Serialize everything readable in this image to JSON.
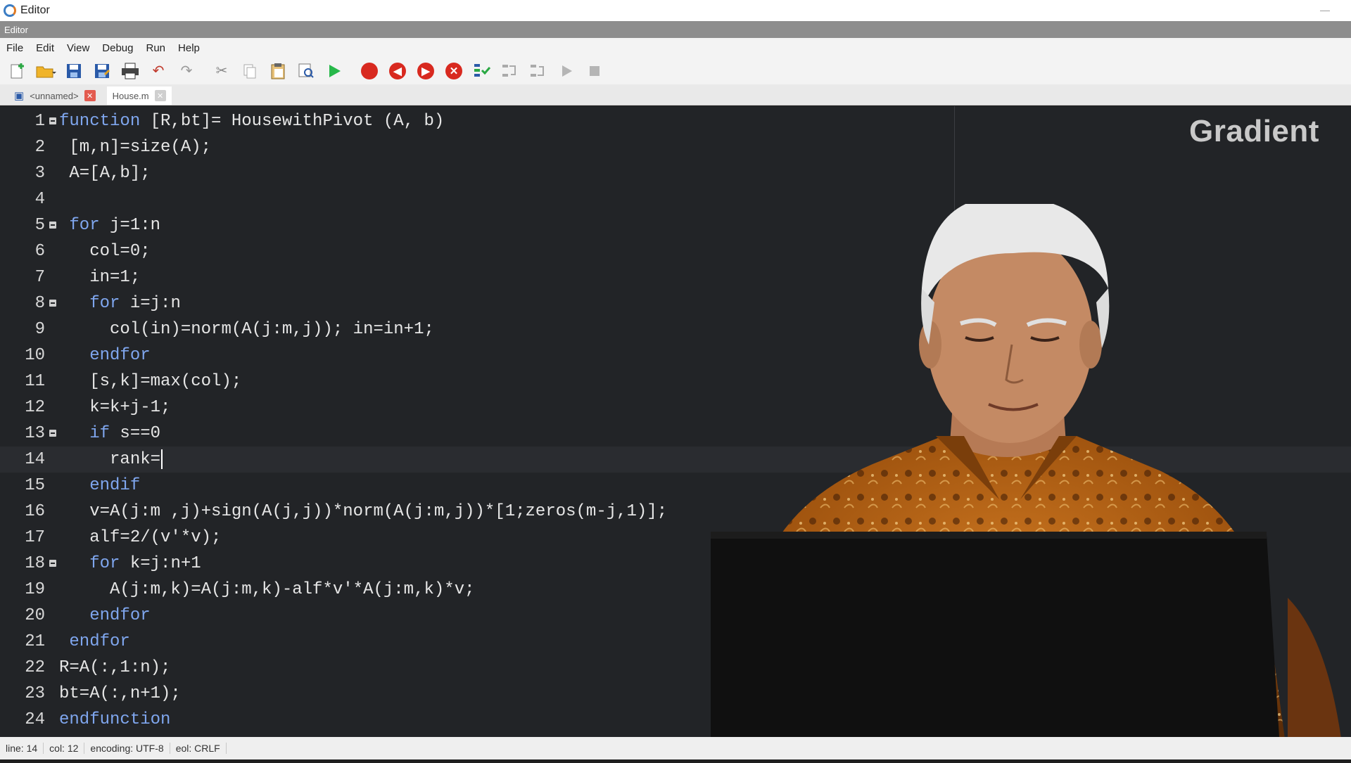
{
  "window": {
    "title": "Editor",
    "dock_title": "Editor"
  },
  "menu": [
    "File",
    "Edit",
    "View",
    "Debug",
    "Run",
    "Help"
  ],
  "toolbar": {
    "icons": [
      "new-script-icon",
      "open-folder-icon",
      "save-icon",
      "save-as-icon",
      "print-icon",
      "undo-icon",
      "redo-icon",
      "cut-icon",
      "copy-icon",
      "paste-icon",
      "find-icon",
      "run-icon",
      "breakpoint-icon",
      "previous-breakpoint-icon",
      "next-breakpoint-icon",
      "remove-breakpoints-icon",
      "step-in-icon",
      "step-over-icon",
      "step-out-icon",
      "continue-icon",
      "stop-icon"
    ]
  },
  "tabs": [
    {
      "label": "<unnamed>",
      "active": false
    },
    {
      "label": "House.m",
      "active": true
    }
  ],
  "editor": {
    "current_line": 14,
    "lines": [
      {
        "n": "1",
        "fold": true
      },
      {
        "n": "2",
        "fold": false
      },
      {
        "n": "3",
        "fold": false
      },
      {
        "n": "4",
        "fold": false
      },
      {
        "n": "5",
        "fold": true
      },
      {
        "n": "6",
        "fold": false
      },
      {
        "n": "7",
        "fold": false
      },
      {
        "n": "8",
        "fold": true
      },
      {
        "n": "9",
        "fold": false
      },
      {
        "n": "10",
        "fold": false
      },
      {
        "n": "11",
        "fold": false
      },
      {
        "n": "12",
        "fold": false
      },
      {
        "n": "13",
        "fold": true
      },
      {
        "n": "14",
        "fold": false
      },
      {
        "n": "15",
        "fold": false
      },
      {
        "n": "16",
        "fold": false
      },
      {
        "n": "17",
        "fold": false
      },
      {
        "n": "18",
        "fold": true
      },
      {
        "n": "19",
        "fold": false
      },
      {
        "n": "20",
        "fold": false
      },
      {
        "n": "21",
        "fold": false
      },
      {
        "n": "22",
        "fold": false
      },
      {
        "n": "23",
        "fold": false
      },
      {
        "n": "24",
        "fold": false
      }
    ],
    "code": [
      [
        {
          "k": true,
          "t": "function"
        },
        {
          "k": false,
          "t": " [R,bt]= HousewithPivot (A, b)"
        }
      ],
      [
        {
          "k": false,
          "t": " [m,n]=size(A);"
        }
      ],
      [
        {
          "k": false,
          "t": " A=[A,b];"
        }
      ],
      [
        {
          "k": false,
          "t": ""
        }
      ],
      [
        {
          "k": false,
          "t": " "
        },
        {
          "k": true,
          "t": "for"
        },
        {
          "k": false,
          "t": " j=1:n"
        }
      ],
      [
        {
          "k": false,
          "t": "   col=0;"
        }
      ],
      [
        {
          "k": false,
          "t": "   in=1;"
        }
      ],
      [
        {
          "k": false,
          "t": "   "
        },
        {
          "k": true,
          "t": "for"
        },
        {
          "k": false,
          "t": " i=j:n"
        }
      ],
      [
        {
          "k": false,
          "t": "     col(in)=norm(A(j:m,j)); in=in+1;"
        }
      ],
      [
        {
          "k": false,
          "t": "   "
        },
        {
          "k": true,
          "t": "endfor"
        }
      ],
      [
        {
          "k": false,
          "t": "   [s,k]=max(col);"
        }
      ],
      [
        {
          "k": false,
          "t": "   k=k+j-1;"
        }
      ],
      [
        {
          "k": false,
          "t": "   "
        },
        {
          "k": true,
          "t": "if"
        },
        {
          "k": false,
          "t": " s==0"
        }
      ],
      [
        {
          "k": false,
          "t": "     rank="
        }
      ],
      [
        {
          "k": false,
          "t": "   "
        },
        {
          "k": true,
          "t": "endif"
        }
      ],
      [
        {
          "k": false,
          "t": "   v=A(j:m ,j)+sign(A(j,j))*norm(A(j:m,j))*[1;zeros(m-j,1)];"
        }
      ],
      [
        {
          "k": false,
          "t": "   alf=2/(v'*v);"
        }
      ],
      [
        {
          "k": false,
          "t": "   "
        },
        {
          "k": true,
          "t": "for"
        },
        {
          "k": false,
          "t": " k=j:n+1"
        }
      ],
      [
        {
          "k": false,
          "t": "     A(j:m,k)=A(j:m,k)-alf*v'*A(j:m,k)*v;"
        }
      ],
      [
        {
          "k": false,
          "t": "   "
        },
        {
          "k": true,
          "t": "endfor"
        }
      ],
      [
        {
          "k": false,
          "t": " "
        },
        {
          "k": true,
          "t": "endfor"
        }
      ],
      [
        {
          "k": false,
          "t": "R=A(:,1:n);"
        }
      ],
      [
        {
          "k": false,
          "t": "bt=A(:,n+1);"
        }
      ],
      [
        {
          "k": true,
          "t": "endfunction"
        }
      ]
    ]
  },
  "watermark": "Gradient",
  "status": {
    "line": "line: 14",
    "col": "col: 12",
    "encoding": "encoding: UTF-8",
    "eol": "eol: CRLF"
  },
  "colors": {
    "keyword": "#7fa6ee",
    "editor_bg": "#222427",
    "text": "#e6e6e6"
  }
}
